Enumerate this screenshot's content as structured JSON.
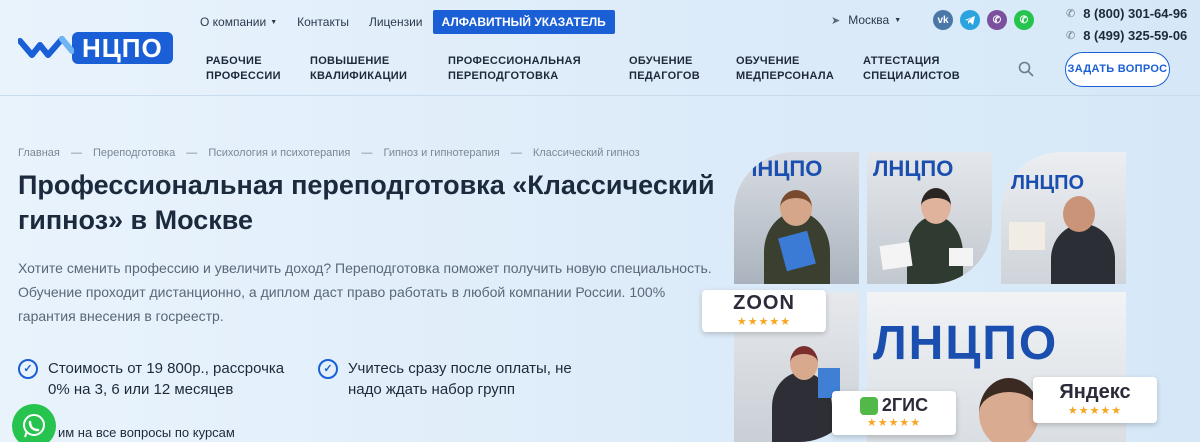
{
  "header": {
    "logo_text": "НЦПО",
    "top_links": [
      {
        "label": "О компании",
        "has_caret": true
      },
      {
        "label": "Контакты",
        "has_caret": false
      },
      {
        "label": "Лицензии",
        "has_caret": false
      }
    ],
    "alphabet_label": "АЛФАВИТНЫЙ УКАЗАТЕЛЬ",
    "city": "Москва",
    "socials": [
      "vk-icon",
      "telegram-icon",
      "viber-icon",
      "whatsapp-icon"
    ],
    "phones": [
      "8 (800) 301-64-96",
      "8 (499) 325-59-06"
    ],
    "main_nav": [
      {
        "line1": "РАБОЧИЕ",
        "line2": "ПРОФЕССИИ"
      },
      {
        "line1": "ПОВЫШЕНИЕ",
        "line2": "КВАЛИФИКАЦИИ"
      },
      {
        "line1": "ПРОФЕССИОНАЛЬНАЯ",
        "line2": "ПЕРЕПОДГОТОВКА"
      },
      {
        "line1": "ОБУЧЕНИЕ",
        "line2": "ПЕДАГОГОВ"
      },
      {
        "line1": "ОБУЧЕНИЕ",
        "line2": "МЕДПЕРСОНАЛА"
      },
      {
        "line1": "АТТЕСТАЦИЯ",
        "line2": "СПЕЦИАЛИСТОВ"
      }
    ],
    "ask_button": "ЗАДАТЬ ВОПРОС"
  },
  "breadcrumbs": [
    "Главная",
    "Переподготовка",
    "Психология и психотерапия",
    "Гипноз и гипнотерапия",
    "Классический гипноз"
  ],
  "breadcrumb_separator": "—",
  "title": "Профессиональная переподготовка «Классический гипноз» в Москве",
  "description": "Хотите сменить профессию и увеличить доход? Переподготовка поможет получить новую специальность. Обучение проходит дистанционно, а диплом даст право работать в любой компании России. 100% гарантия внесения в госреестр.",
  "features": [
    "Стоимость от 19 800р., рассрочка 0% на 3, 6 или 12 месяцев",
    "Учитесь сразу после оплаты, не надо ждать набор групп"
  ],
  "partial_line": "им на все вопросы по курсам",
  "badges": [
    {
      "name": "ZOON",
      "stars": "★★★★★"
    },
    {
      "name": "2ГИС",
      "stars": "★★★★★"
    },
    {
      "name": "Яндекс",
      "stars": "★★★★★"
    }
  ],
  "colors": {
    "accent": "#1a5fd6",
    "whatsapp": "#27c34f",
    "vk": "#4a76a8",
    "telegram": "#2aa3df",
    "viber": "#7b519d",
    "star": "#f5a623"
  }
}
